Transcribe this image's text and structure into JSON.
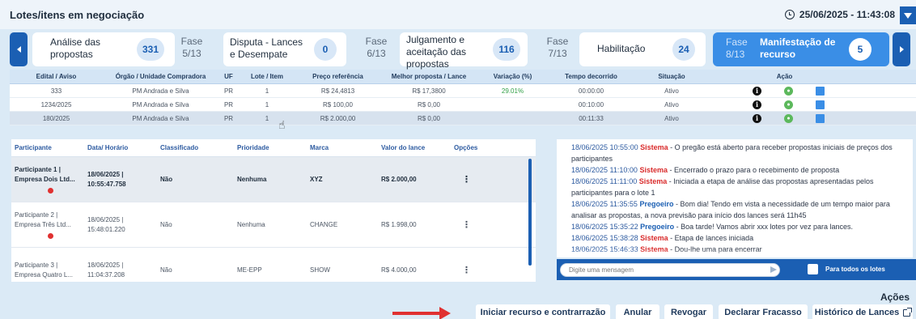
{
  "header": {
    "title": "Lotes/itens em negociação",
    "datetime": "25/06/2025 - 11:43:08"
  },
  "phases": [
    {
      "name": "Análise das propostas",
      "count": "331"
    },
    {
      "num": "Fase 5/13",
      "name": "Disputa - Lances e Desempate",
      "count": "0"
    },
    {
      "num": "Fase 6/13",
      "name": "Julgamento e aceitação das propostas",
      "count": "116"
    },
    {
      "num": "Fase 7/13",
      "name": "Habilitação",
      "count": "24"
    },
    {
      "num": "Fase 8/13",
      "name": "Manifestação de recurso",
      "count": "5",
      "active": true
    }
  ],
  "top_table": {
    "headers": [
      "Edital / Aviso",
      "Órgão / Unidade Compradora",
      "UF",
      "Lote / Item",
      "Preço referência",
      "Melhor proposta / Lance",
      "Variação (%)",
      "Tempo decorrido",
      "Situação",
      "Ação"
    ],
    "rows": [
      [
        "333",
        "PM Andrada e Silva",
        "PR",
        "1",
        "R$ 24,4813",
        "R$ 17,3800",
        "29.01%",
        "00:00:00",
        "Ativo"
      ],
      [
        "1234/2025",
        "PM Andrada e Silva",
        "PR",
        "1",
        "R$ 100,00",
        "R$ 0,00",
        "",
        "00:10:00",
        "Ativo"
      ],
      [
        "180/2025",
        "PM Andrada e Silva",
        "PR",
        "1",
        "R$ 2.000,00",
        "R$ 0,00",
        "",
        "00:11:33",
        "Ativo"
      ]
    ]
  },
  "participants": {
    "headers": [
      "Participante",
      "Data/ Horário",
      "Classificado",
      "Prioridade",
      "Marca",
      "Valor do lance",
      "Opções"
    ],
    "rows": [
      {
        "name": "Participante 1 | Empresa Dois Ltd...",
        "date": "18/06/2025 | 10:55:47.758",
        "classificado": "Não",
        "prioridade": "Nenhuma",
        "marca": "XYZ",
        "valor": "R$ 2.000,00",
        "dot": true
      },
      {
        "name": "Participante 2 | Empresa Três Ltd...",
        "date": "18/06/2025 | 15:48:01.220",
        "classificado": "Não",
        "prioridade": "Nenhuma",
        "marca": "CHANGE",
        "valor": "R$ 1.998,00",
        "dot": true
      },
      {
        "name": "Participante 3 | Empresa Quatro L...",
        "date": "18/06/2025 | 11:04:37.208",
        "classificado": "Não",
        "prioridade": "ME-EPP",
        "marca": "SHOW",
        "valor": "R$ 4.000,00",
        "dot": false
      }
    ]
  },
  "log": [
    {
      "ts": "18/06/2025 10:55:00",
      "who": "Sistema",
      "msg": "O pregão está aberto para receber propostas iniciais de preços dos participantes"
    },
    {
      "ts": "18/06/2025 11:10:00",
      "who": "Sistema",
      "msg": "Encerrado o prazo para o recebimento de proposta"
    },
    {
      "ts": "18/06/2025 11:11:00",
      "who": "Sistema",
      "msg": "Iniciada a etapa de análise das propostas apresentadas pelos participantes para o lote 1"
    },
    {
      "ts": "18/06/2025 11:35:55",
      "who": "Pregoeiro",
      "msg": "Bom dia! Tendo em vista a necessidade de um tempo maior para analisar as propostas, a nova previsão para início dos lances será 11h45"
    },
    {
      "ts": "18/06/2025 15:35:22",
      "who": "Pregoeiro",
      "msg": "Boa tarde! Vamos abrir xxx lotes por vez para lances."
    },
    {
      "ts": "18/06/2025 15:38:28",
      "who": "Sistema",
      "msg": "Etapa de lances iniciada"
    },
    {
      "ts": "18/06/2025 15:46:33",
      "who": "Sistema",
      "msg": "Dou-lhe uma para encerrar"
    }
  ],
  "chat": {
    "placeholder": "Digite uma mensagem",
    "checkbox_label": "Para todos os lotes"
  },
  "actions": {
    "title": "Ações",
    "buttons": [
      "Iniciar recurso e contrarrazão",
      "Anular",
      "Revogar",
      "Declarar Fracasso",
      "Histórico de Lances"
    ]
  },
  "icons": {
    "info": "info-icon",
    "status": "green-status-icon",
    "square": "blue-square-icon"
  },
  "colors": {
    "primary": "#1b5fb3",
    "active_phase": "#3a8ee6",
    "alert": "#e03131",
    "positive": "#2f9e44"
  }
}
